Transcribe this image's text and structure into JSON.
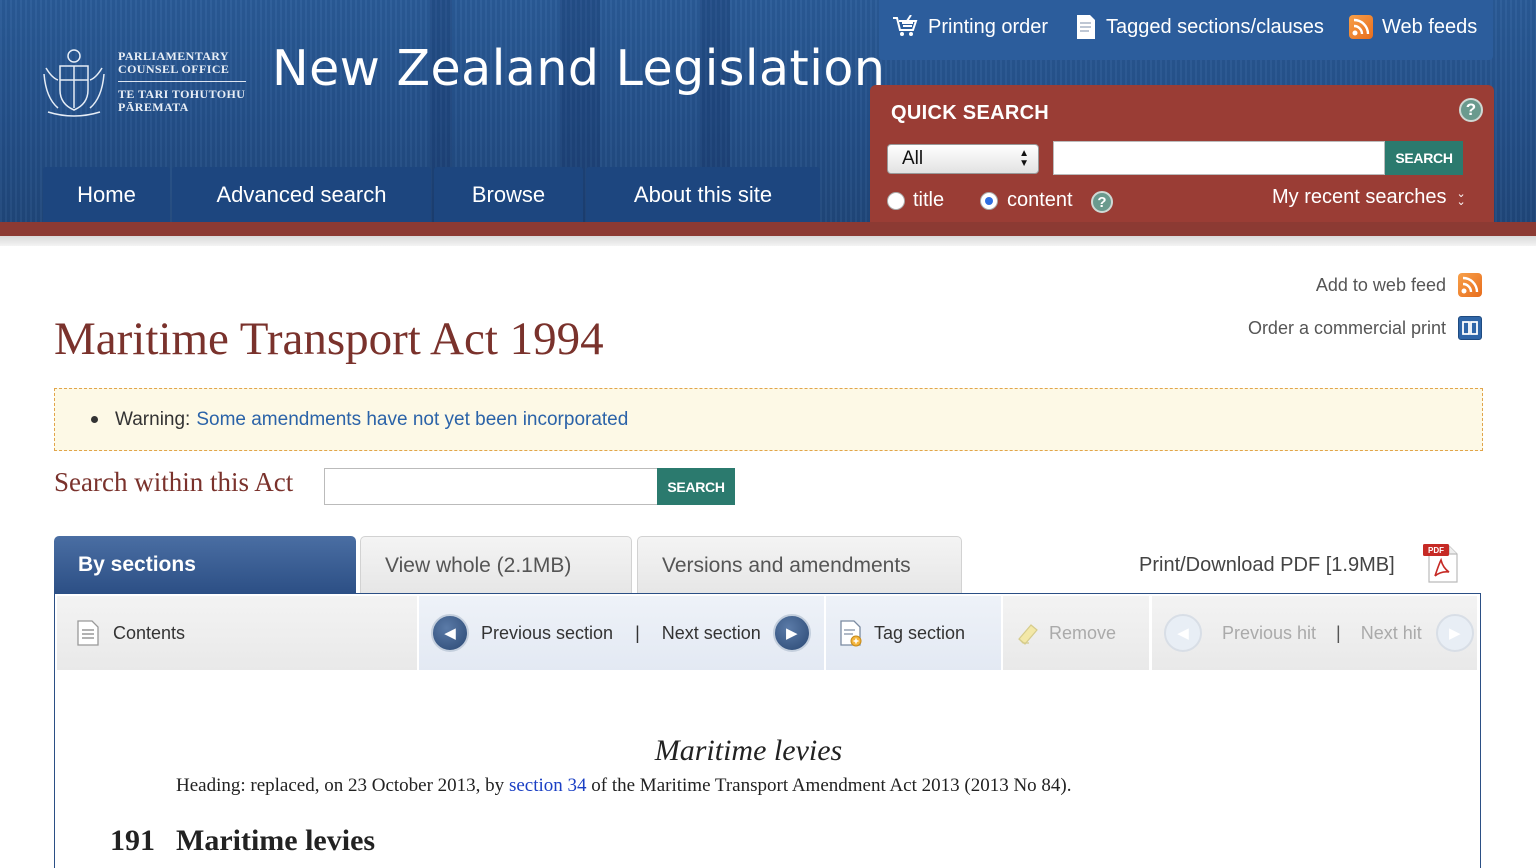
{
  "header": {
    "pco_line1": "PARLIAMENTARY",
    "pco_line2": "COUNSEL OFFICE",
    "pco_line3": "TE TARI TOHUTOHU",
    "pco_line4": "PĀREMATA",
    "site_title": "New Zealand Legislation"
  },
  "nav": [
    {
      "label": "Home"
    },
    {
      "label": "Advanced search"
    },
    {
      "label": "Browse"
    },
    {
      "label": "About this site"
    }
  ],
  "utility": {
    "printing_order": "Printing order",
    "tagged": "Tagged sections/clauses",
    "web_feeds": "Web feeds"
  },
  "quick_search": {
    "title": "QUICK SEARCH",
    "help": "?",
    "select_value": "All",
    "input_value": "",
    "button": "SEARCH",
    "radio_title": "title",
    "radio_content": "content",
    "selected_radio": "content",
    "recent": "My recent searches"
  },
  "side_links": {
    "web_feed": "Add to web feed",
    "commercial_print": "Order a commercial print"
  },
  "act": {
    "title": "Maritime Transport Act 1994",
    "warning_label": "Warning:",
    "warning_link": "Some amendments have not yet been incorporated",
    "search_label": "Search within this Act",
    "search_value": "",
    "search_button": "SEARCH"
  },
  "tabs": [
    {
      "label": "By sections",
      "active": true
    },
    {
      "label": "View whole (2.1MB)",
      "active": false
    },
    {
      "label": "Versions and amendments",
      "active": false
    }
  ],
  "pdf": {
    "label": "Print/Download PDF [1.9MB]",
    "icon_text": "PDF"
  },
  "toolbar": {
    "contents": "Contents",
    "previous_section": "Previous section",
    "separator": "|",
    "next_section": "Next section",
    "tag_section": "Tag section",
    "remove": "Remove",
    "previous_hit": "Previous hit",
    "next_hit": "Next hit"
  },
  "content": {
    "heading": "Maritime levies",
    "note_prefix": "Heading: replaced, on 23 October 2013, by",
    "note_link": "section 34",
    "note_suffix": "of the Maritime Transport Amendment Act 2013 (2013 No 84).",
    "section_number": "191",
    "section_title": "Maritime levies"
  },
  "colors": {
    "header_blue": "#2a5b98",
    "nav_blue": "#1d467f",
    "search_red": "#9a3d35",
    "search_green": "#2b7a6e",
    "title_maroon": "#7a322c",
    "link_blue": "#2b63a8"
  }
}
